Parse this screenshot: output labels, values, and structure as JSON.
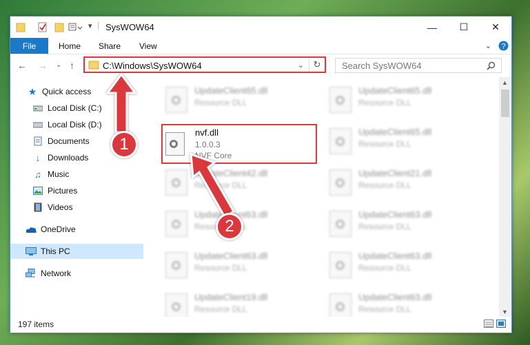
{
  "window": {
    "title": "SysWOW64",
    "minimize": "—",
    "maximize": "☐",
    "close": "✕"
  },
  "ribbon": {
    "file": "File",
    "home": "Home",
    "share": "Share",
    "view": "View",
    "expand_icon": "chevron-down-icon",
    "help_icon": "help-icon"
  },
  "address": {
    "path": "C:\\Windows\\SysWOW64",
    "search_placeholder": "Search SysWOW64"
  },
  "nav": {
    "items": [
      {
        "label": "Quick access",
        "icon": "star-icon"
      },
      {
        "label": "Local Disk (C:)",
        "icon": "drive-icon",
        "pinned": true
      },
      {
        "label": "Local Disk (D:)",
        "icon": "drive-icon",
        "pinned": true
      },
      {
        "label": "Documents",
        "icon": "documents-icon",
        "pinned": true
      },
      {
        "label": "Downloads",
        "icon": "download-icon",
        "pinned": true
      },
      {
        "label": "Music",
        "icon": "music-icon",
        "pinned": true
      },
      {
        "label": "Pictures",
        "icon": "pictures-icon",
        "pinned": true
      },
      {
        "label": "Videos",
        "icon": "videos-icon",
        "pinned": true
      },
      {
        "label": "OneDrive",
        "icon": "cloud-icon"
      },
      {
        "label": "This PC",
        "icon": "computer-icon",
        "selected": true
      },
      {
        "label": "Network",
        "icon": "network-icon"
      }
    ]
  },
  "files": {
    "highlighted": {
      "name": "nvf.dll",
      "version": "1.0.0.3",
      "description": "NVF Core"
    },
    "background": [
      {
        "name": "UpdateClient65.dll",
        "desc": "Resource DLL"
      },
      {
        "name": "UpdateClient65.dll",
        "desc": "Resource DLL"
      },
      {
        "name": "UpdateClient65.dll",
        "desc": "Resource DLL"
      },
      {
        "name": "UpdateClient42.dll",
        "desc": "Resource DLL"
      },
      {
        "name": "UpdateClient21.dll",
        "desc": "Resource DLL"
      },
      {
        "name": "UpdateClient63.dll",
        "desc": "Resource DLL"
      },
      {
        "name": "UpdateClient63.dll",
        "desc": "Resource DLL"
      },
      {
        "name": "UpdateClient63.dll",
        "desc": "Resource DLL"
      },
      {
        "name": "UpdateClient63.dll",
        "desc": "Resource DLL"
      },
      {
        "name": "UpdateClient19.dll",
        "desc": "Resource DLL"
      },
      {
        "name": "UpdateClient63.dll",
        "desc": "Resource DLL"
      }
    ]
  },
  "status": {
    "item_count": "197 items"
  },
  "annotations": {
    "step1": "1",
    "step2": "2",
    "color": "#d9393e"
  }
}
